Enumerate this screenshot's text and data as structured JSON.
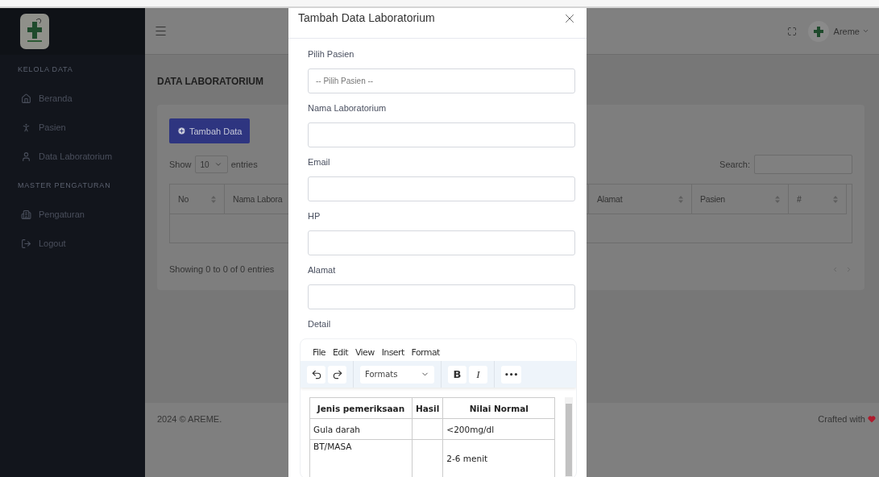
{
  "sidebar": {
    "sections": [
      {
        "title": "KELOLA DATA",
        "items": [
          {
            "label": "Beranda",
            "kind": "home"
          },
          {
            "label": "Pasien",
            "kind": "person"
          },
          {
            "label": "Data Laboratorium",
            "kind": "user"
          }
        ]
      },
      {
        "title": "MASTER PENGATURAN",
        "items": [
          {
            "label": "Pengaturan",
            "kind": "building"
          },
          {
            "label": "Logout",
            "kind": "logout"
          }
        ]
      }
    ]
  },
  "header": {
    "user": "Areme"
  },
  "page": {
    "title": "DATA LABORATORIUM",
    "add_button": "Tambah Data",
    "show_label": "Show",
    "entries_value": "10",
    "entries_label": "entries",
    "search_label": "Search:",
    "columns": [
      {
        "label": "No"
      },
      {
        "label": "Nama Labora"
      },
      {
        "label": "Alamat"
      },
      {
        "label": "Pasien"
      },
      {
        "label": "#"
      }
    ],
    "info": "Showing 0 to 0 of 0 entries"
  },
  "footer": {
    "copyright": "2024 © AREME.",
    "credit": "Crafted with"
  },
  "modal": {
    "title": "Tambah Data Laboratorium",
    "fields": [
      {
        "label": "Pilih Pasien",
        "placeholder": "-- Pilih Pasien --"
      },
      {
        "label": "Nama Laboratorium"
      },
      {
        "label": "Email"
      },
      {
        "label": "HP"
      },
      {
        "label": "Alamat"
      }
    ],
    "detail_label": "Detail",
    "editor": {
      "menu": [
        "File",
        "Edit",
        "View",
        "Insert",
        "Format"
      ],
      "format_select": "Formats",
      "bold": "B",
      "italic": "I",
      "more": "•••",
      "table": {
        "columns": [
          "Jenis pemeriksaan",
          "Hasil",
          "Nilai Normal"
        ],
        "rows": [
          {
            "jenis": "Gula darah",
            "nilai": "<200mg/dl"
          },
          {
            "jenis": "BT/MASA",
            "nilai": "2-6 menit"
          }
        ]
      }
    }
  }
}
